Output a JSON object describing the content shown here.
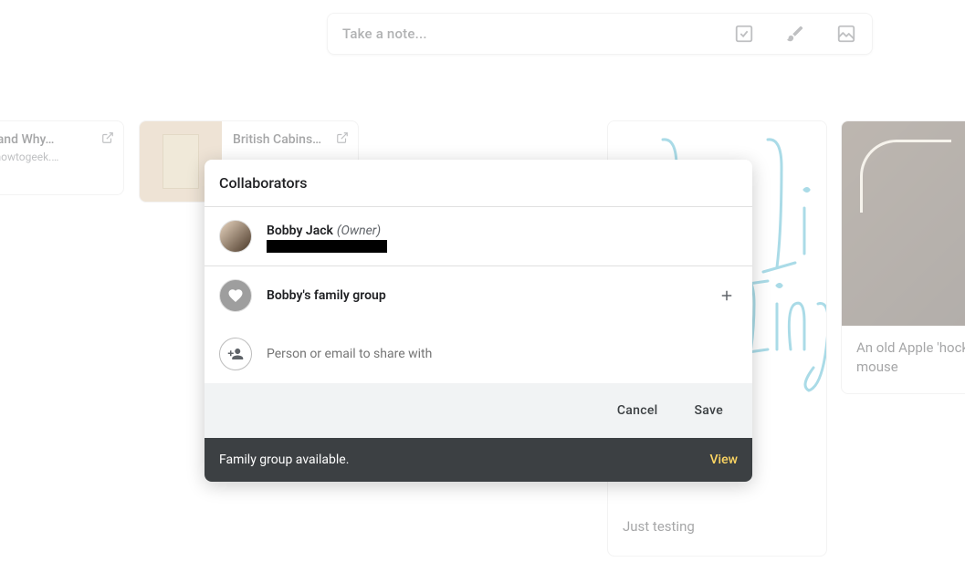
{
  "note_input": {
    "placeholder": "Take a note...",
    "icons": {
      "checkbox": "checkbox-icon",
      "brush": "brush-icon",
      "image": "image-icon"
    }
  },
  "notes": [
    {
      "title": "How and Why…",
      "subtitle": "www.howtogeek.…"
    },
    {
      "title": "British Cabins…"
    },
    {
      "caption": "Just testing"
    },
    {
      "caption": "An old Apple 'hockey puck' mouse"
    }
  ],
  "dialog": {
    "title": "Collaborators",
    "owner": {
      "name": "Bobby Jack",
      "role": "(Owner)"
    },
    "family_group": {
      "name": "Bobby's family group"
    },
    "share_placeholder": "Person or email to share with",
    "buttons": {
      "cancel": "Cancel",
      "save": "Save"
    },
    "banner": {
      "message": "Family group available.",
      "action": "View"
    }
  }
}
